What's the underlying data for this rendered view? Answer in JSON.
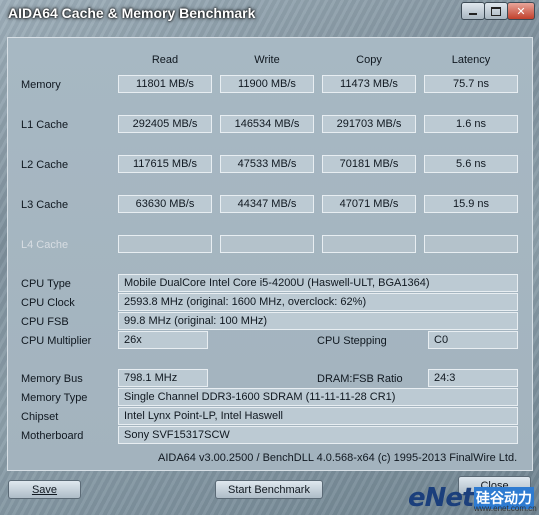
{
  "window": {
    "title": "AIDA64 Cache & Memory Benchmark"
  },
  "columns": [
    "Read",
    "Write",
    "Copy",
    "Latency"
  ],
  "rows": [
    {
      "label": "Memory",
      "values": [
        "11801 MB/s",
        "11900 MB/s",
        "11473 MB/s",
        "75.7 ns"
      ]
    },
    {
      "label": "L1 Cache",
      "values": [
        "292405 MB/s",
        "146534 MB/s",
        "291703 MB/s",
        "1.6 ns"
      ]
    },
    {
      "label": "L2 Cache",
      "values": [
        "117615 MB/s",
        "47533 MB/s",
        "70181 MB/s",
        "5.6 ns"
      ]
    },
    {
      "label": "L3 Cache",
      "values": [
        "63630 MB/s",
        "44347 MB/s",
        "47071 MB/s",
        "15.9 ns"
      ]
    },
    {
      "label": "L4 Cache",
      "values": [
        "",
        "",
        "",
        ""
      ]
    }
  ],
  "info": {
    "cpu_type_label": "CPU Type",
    "cpu_type": "Mobile DualCore Intel Core i5-4200U  (Haswell-ULT, BGA1364)",
    "cpu_clock_label": "CPU Clock",
    "cpu_clock": "2593.8 MHz  (original: 1600 MHz, overclock: 62%)",
    "cpu_fsb_label": "CPU FSB",
    "cpu_fsb": "99.8 MHz  (original: 100 MHz)",
    "cpu_multiplier_label": "CPU Multiplier",
    "cpu_multiplier": "26x",
    "cpu_stepping_label": "CPU Stepping",
    "cpu_stepping": "C0",
    "memory_bus_label": "Memory Bus",
    "memory_bus": "798.1 MHz",
    "dram_fsb_label": "DRAM:FSB Ratio",
    "dram_fsb": "24:3",
    "memory_type_label": "Memory Type",
    "memory_type": "Single Channel DDR3-1600 SDRAM  (11-11-11-28 CR1)",
    "chipset_label": "Chipset",
    "chipset": "Intel Lynx Point-LP, Intel Haswell",
    "motherboard_label": "Motherboard",
    "motherboard": "Sony SVF15317SCW"
  },
  "footer": "AIDA64 v3.00.2500 / BenchDLL 4.0.568-x64  (c) 1995-2013 FinalWire Ltd.",
  "buttons": {
    "save": "Save",
    "start": "Start Benchmark",
    "close": "Close"
  },
  "watermark": {
    "brand": "eNet",
    "chinese": "硅谷动力",
    "url": "www.enet.com.cn"
  }
}
